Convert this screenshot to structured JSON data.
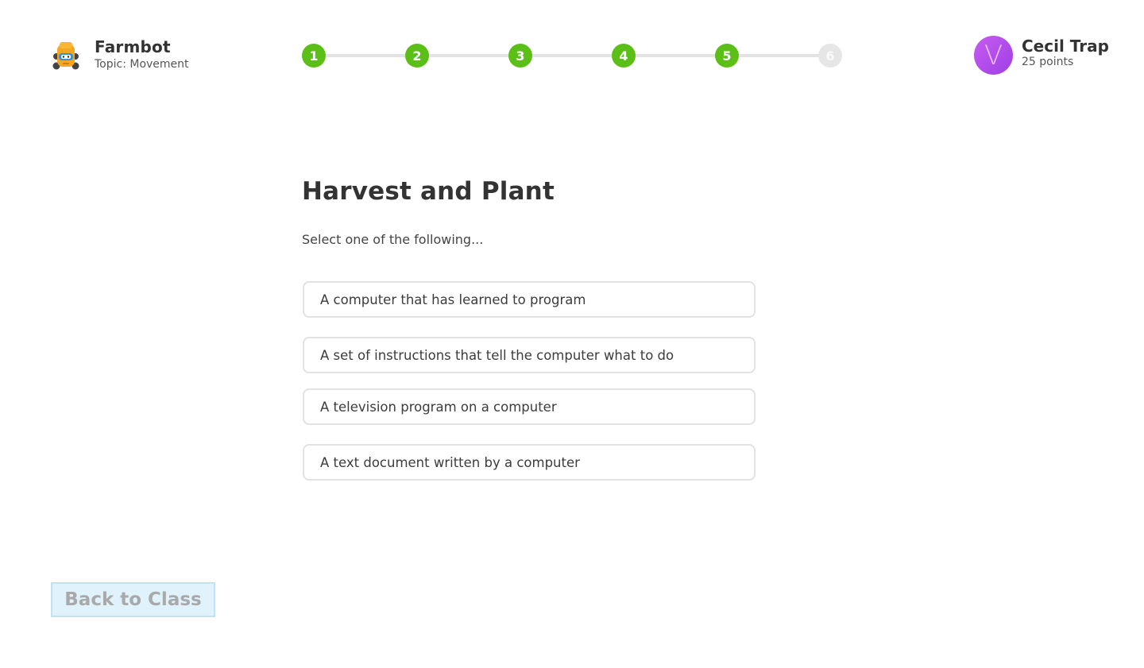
{
  "header": {
    "app_title": "Farmbot",
    "topic_label": "Topic: Movement",
    "logo_icon": "farmbot-robot-icon"
  },
  "progress": {
    "steps": [
      {
        "label": "1",
        "status": "complete"
      },
      {
        "label": "2",
        "status": "complete"
      },
      {
        "label": "3",
        "status": "complete"
      },
      {
        "label": "4",
        "status": "complete"
      },
      {
        "label": "5",
        "status": "complete"
      },
      {
        "label": "6",
        "status": "pending"
      }
    ],
    "complete_color": "#5cbf17",
    "pending_color": "#e6e6e6"
  },
  "user": {
    "avatar_letter": "V",
    "name": "Cecil Trap",
    "points": "25 points",
    "avatar_color": "#b04de8"
  },
  "question": {
    "title": "Harvest and Plant",
    "prompt": "Select one of the following...",
    "options": [
      "A computer that has learned to program",
      "A set of instructions that tell the computer what to do",
      "A television program on a computer",
      "A text document written by a computer"
    ]
  },
  "footer": {
    "back_label": "Back to Class"
  }
}
